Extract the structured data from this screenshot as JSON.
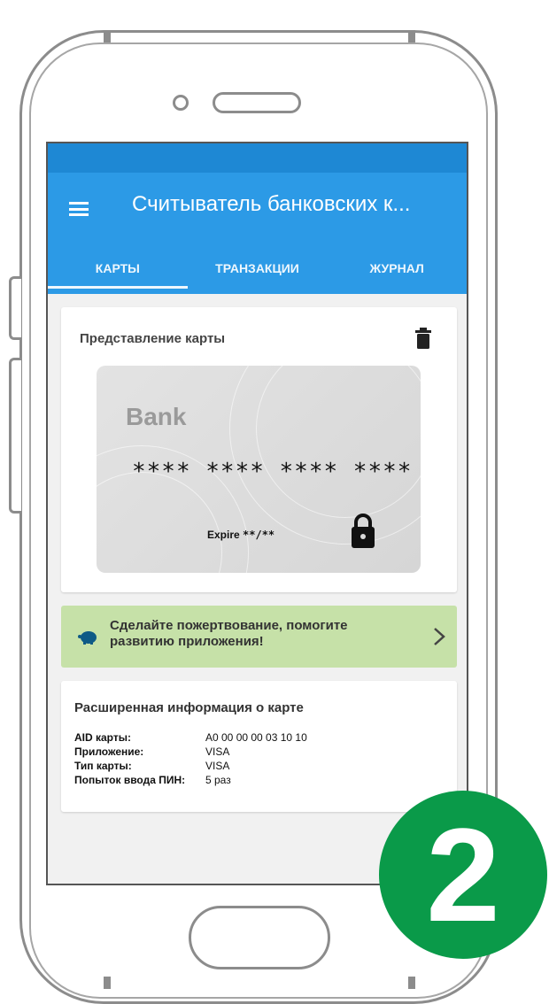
{
  "app": {
    "title": "Считыватель банковских к..."
  },
  "tabs": [
    {
      "label": "КАРТЫ",
      "active": true
    },
    {
      "label": "ТРАНЗАКЦИИ",
      "active": false
    },
    {
      "label": "ЖУРНАЛ",
      "active": false
    }
  ],
  "card_view": {
    "title": "Представление карты",
    "bank_name": "Bank",
    "card_number": "**** **** **** ****",
    "expire_label": "Expire",
    "expire_value": "**/**"
  },
  "donate": {
    "text": "Сделайте пожертвование, помогите развитию приложения!"
  },
  "extended_info": {
    "title": "Расширенная информация о карте",
    "rows": [
      {
        "key": "AID карты:",
        "value": "A0 00 00 00 03 10 10"
      },
      {
        "key": "Приложение:",
        "value": "VISA"
      },
      {
        "key": "Тип карты:",
        "value": "VISA"
      },
      {
        "key": "Попыток ввода ПИН:",
        "value": "5 раз"
      }
    ]
  },
  "badge": {
    "number": "2"
  },
  "colors": {
    "appbar": "#2c9ae6",
    "statusbar": "#1e88d4",
    "donate_bg": "#c6e1a8",
    "badge": "#0a9a49"
  }
}
